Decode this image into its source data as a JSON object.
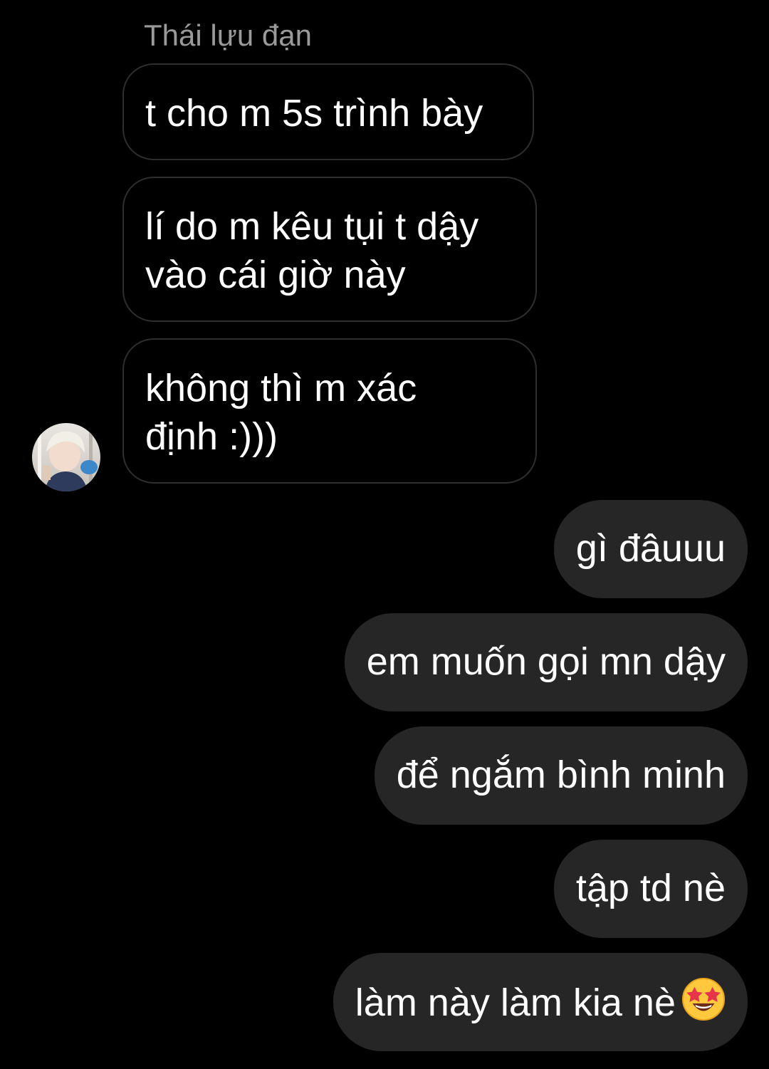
{
  "chat": {
    "sender_name": "Thái lựu đạn",
    "avatar_icon": "profile-photo",
    "incoming": [
      "t cho m 5s trình bày",
      "lí do m kêu tụi t dậy\nvào cái giờ này",
      "không thì m xác\nđịnh :)))"
    ],
    "outgoing": [
      "gì đâuuu",
      "em muốn gọi mn dậy",
      "để ngắm bình minh",
      "tập td nè",
      "làm này làm kia nè"
    ],
    "last_emoji_icon": "star-struck-emoji"
  },
  "colors": {
    "background": "#000000",
    "incoming_border": "#2e2e2e",
    "outgoing_bubble": "#262626",
    "sender_name": "#9a9a9a",
    "text": "#ffffff"
  }
}
